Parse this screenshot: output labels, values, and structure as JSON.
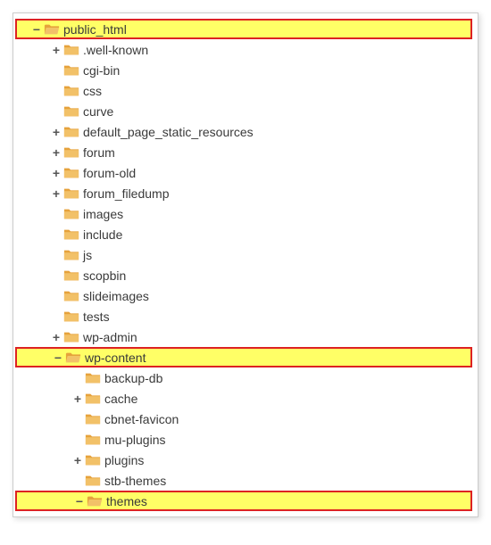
{
  "icons": {
    "plus": "+",
    "minus": "−"
  },
  "tree": [
    {
      "depth": 0,
      "toggle": "minus",
      "open": true,
      "label": "public_html",
      "highlight": true
    },
    {
      "depth": 1,
      "toggle": "plus",
      "open": false,
      "label": ".well-known"
    },
    {
      "depth": 1,
      "toggle": "none",
      "open": false,
      "label": "cgi-bin"
    },
    {
      "depth": 1,
      "toggle": "none",
      "open": false,
      "label": "css"
    },
    {
      "depth": 1,
      "toggle": "none",
      "open": false,
      "label": "curve"
    },
    {
      "depth": 1,
      "toggle": "plus",
      "open": false,
      "label": "default_page_static_resources"
    },
    {
      "depth": 1,
      "toggle": "plus",
      "open": false,
      "label": "forum"
    },
    {
      "depth": 1,
      "toggle": "plus",
      "open": false,
      "label": "forum-old"
    },
    {
      "depth": 1,
      "toggle": "plus",
      "open": false,
      "label": "forum_filedump"
    },
    {
      "depth": 1,
      "toggle": "none",
      "open": false,
      "label": "images"
    },
    {
      "depth": 1,
      "toggle": "none",
      "open": false,
      "label": "include"
    },
    {
      "depth": 1,
      "toggle": "none",
      "open": false,
      "label": "js"
    },
    {
      "depth": 1,
      "toggle": "none",
      "open": false,
      "label": "scopbin"
    },
    {
      "depth": 1,
      "toggle": "none",
      "open": false,
      "label": "slideimages"
    },
    {
      "depth": 1,
      "toggle": "none",
      "open": false,
      "label": "tests"
    },
    {
      "depth": 1,
      "toggle": "plus",
      "open": false,
      "label": "wp-admin"
    },
    {
      "depth": 1,
      "toggle": "minus",
      "open": true,
      "label": "wp-content",
      "highlight": true
    },
    {
      "depth": 2,
      "toggle": "none",
      "open": false,
      "label": "backup-db"
    },
    {
      "depth": 2,
      "toggle": "plus",
      "open": false,
      "label": "cache"
    },
    {
      "depth": 2,
      "toggle": "none",
      "open": false,
      "label": "cbnet-favicon"
    },
    {
      "depth": 2,
      "toggle": "none",
      "open": false,
      "label": "mu-plugins"
    },
    {
      "depth": 2,
      "toggle": "plus",
      "open": false,
      "label": "plugins"
    },
    {
      "depth": 2,
      "toggle": "none",
      "open": false,
      "label": "stb-themes"
    },
    {
      "depth": 2,
      "toggle": "minus",
      "open": true,
      "label": "themes",
      "highlight": true
    }
  ],
  "indentUnit": 24,
  "baseIndent": 14
}
